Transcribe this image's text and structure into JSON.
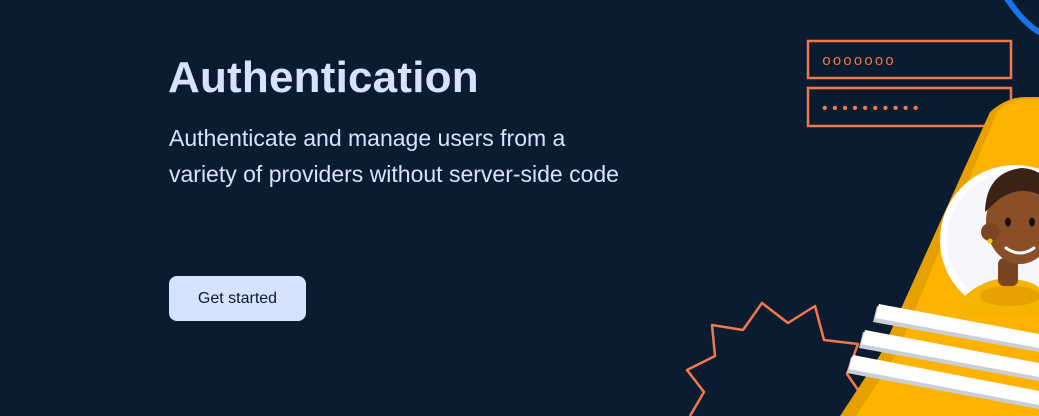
{
  "hero": {
    "title": "Authentication",
    "description": "Authenticate and manage users from a variety of providers without server-side code",
    "cta_label": "Get started"
  },
  "illustration": {
    "username_field_value": "ooooooo",
    "password_field_value": "••••••••••"
  },
  "colors": {
    "background": "#0b1b30",
    "text": "#d6e3ff",
    "button_bg": "#d6e3ff",
    "accent_orange": "#f2784b",
    "card_yellow": "#ffb300",
    "ring_blue": "#1a73e8"
  }
}
